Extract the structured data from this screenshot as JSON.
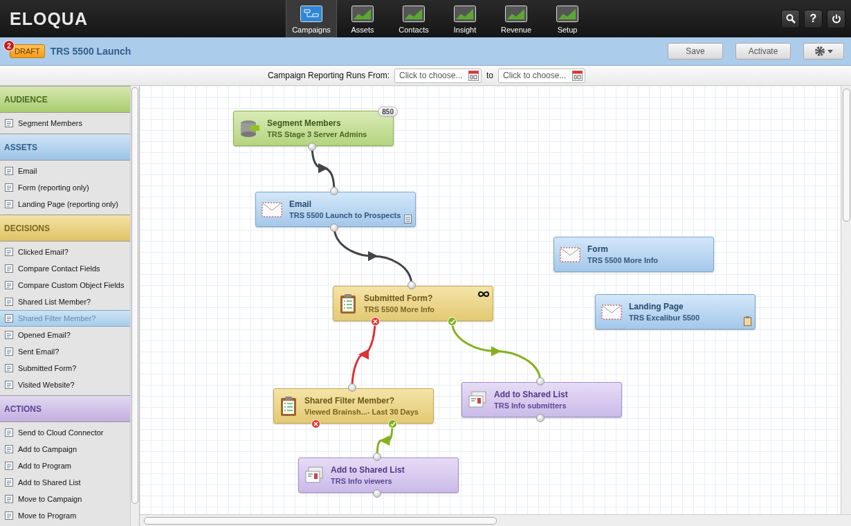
{
  "app": {
    "logo": "ELOQUA"
  },
  "nav": [
    {
      "label": "Campaigns",
      "selected": true
    },
    {
      "label": "Assets",
      "selected": false
    },
    {
      "label": "Contacts",
      "selected": false
    },
    {
      "label": "Insight",
      "selected": false
    },
    {
      "label": "Revenue",
      "selected": false
    },
    {
      "label": "Setup",
      "selected": false
    }
  ],
  "top_buttons": [
    {
      "kind": "search"
    },
    {
      "kind": "help",
      "label": "?"
    },
    {
      "kind": "power"
    }
  ],
  "campaign": {
    "notification_count": "2",
    "status": "DRAFT",
    "title": "TRS 5500 Launch",
    "buttons": [
      "Save",
      "Activate"
    ]
  },
  "reporting": {
    "label": "Campaign Reporting Runs From:",
    "from_placeholder": "Click to choose...",
    "to_label": "to",
    "to_placeholder": "Click to choose..."
  },
  "sidebar": [
    {
      "title": "AUDIENCE",
      "kind": "audience",
      "items": [
        {
          "label": "Segment Members",
          "selected": false
        }
      ]
    },
    {
      "title": "ASSETS",
      "kind": "assets",
      "items": [
        {
          "label": "Email",
          "selected": false
        },
        {
          "label": "Form (reporting only)",
          "selected": false
        },
        {
          "label": "Landing Page (reporting only)",
          "selected": false
        }
      ]
    },
    {
      "title": "DECISIONS",
      "kind": "decisions",
      "items": [
        {
          "label": "Clicked Email?",
          "selected": false
        },
        {
          "label": "Compare Contact Fields",
          "selected": false
        },
        {
          "label": "Compare Custom Object Fields",
          "selected": false
        },
        {
          "label": "Shared List Member?",
          "selected": false
        },
        {
          "label": "Shared Filter Member?",
          "selected": true
        },
        {
          "label": "Opened Email?",
          "selected": false
        },
        {
          "label": "Sent Email?",
          "selected": false
        },
        {
          "label": "Submitted Form?",
          "selected": false
        },
        {
          "label": "Visited Website?",
          "selected": false
        }
      ]
    },
    {
      "title": "ACTIONS",
      "kind": "actions",
      "items": [
        {
          "label": "Send to Cloud Connector",
          "selected": false
        },
        {
          "label": "Add to Campaign",
          "selected": false
        },
        {
          "label": "Add to Program",
          "selected": false
        },
        {
          "label": "Add to Shared List",
          "selected": false
        },
        {
          "label": "Move to Campaign",
          "selected": false
        },
        {
          "label": "Move to Program",
          "selected": false
        }
      ]
    }
  ],
  "canvas": {
    "nodes": [
      {
        "kind": "audience",
        "title": "Segment Members",
        "subtitle": "TRS Stage 3 Server Admins",
        "count": "850"
      },
      {
        "kind": "assets",
        "title": "Email",
        "subtitle": "TRS 5500 Launch to Prospects"
      },
      {
        "kind": "decisions",
        "title": "Submitted Form?",
        "subtitle": "TRS 5500 More Info"
      },
      {
        "kind": "assets",
        "title": "Form",
        "subtitle": "TRS 5500 More Info"
      },
      {
        "kind": "assets",
        "title": "Landing Page",
        "subtitle": "TRS Excalibur 5500"
      },
      {
        "kind": "decisions",
        "title": "Shared Filter Member?",
        "subtitle": "Viewed Brainsh...- Last 30 Days"
      },
      {
        "kind": "actions",
        "title": "Add to Shared List",
        "subtitle": "TRS Info submitters"
      },
      {
        "kind": "actions",
        "title": "Add to Shared List",
        "subtitle": "TRS Info viewers"
      }
    ],
    "connections": [
      {
        "kind": "default"
      },
      {
        "kind": "default"
      },
      {
        "kind": "no"
      },
      {
        "kind": "yes"
      },
      {
        "kind": "yes"
      }
    ]
  }
}
